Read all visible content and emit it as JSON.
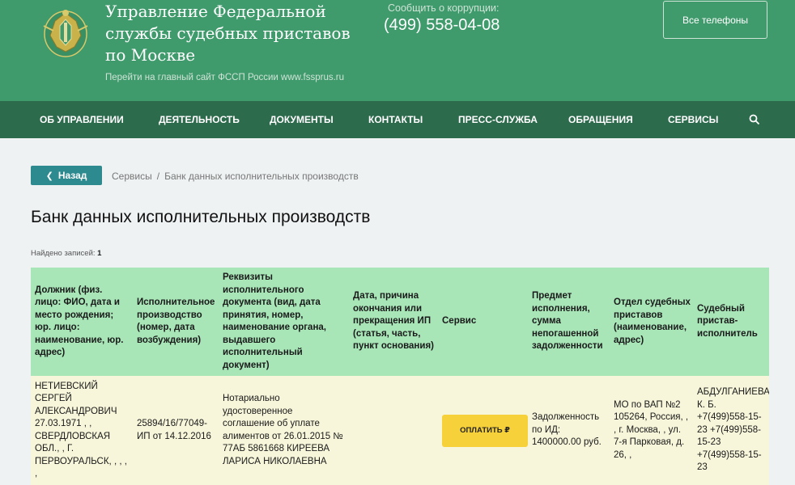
{
  "header": {
    "org_title": "Управление Федеральной службы судебных приставов по Москве",
    "main_site_link": "Перейти на главный сайт ФССП России www.fssprus.ru",
    "corruption_label": "Сообщить о коррупции:",
    "corruption_phone": "(499) 558-04-08",
    "all_phones": "Все телефоны"
  },
  "nav": {
    "items": [
      "ОБ УПРАВЛЕНИИ",
      "ДЕЯТЕЛЬНОСТЬ",
      "ДОКУМЕНТЫ",
      "КОНТАКТЫ",
      "ПРЕСС-СЛУЖБА",
      "ОБРАЩЕНИЯ",
      "СЕРВИСЫ"
    ]
  },
  "breadcrumb": {
    "back_label": "Назад",
    "items": [
      "Сервисы",
      "Банк данных исполнительных производств"
    ],
    "separator": "/"
  },
  "page": {
    "title": "Банк данных исполнительных производств",
    "records_label": "Найдено записей:",
    "records_count": "1"
  },
  "table": {
    "headers": [
      "Должник (физ. лицо: ФИО, дата и место рождения; юр. лицо: наименование, юр. адрес)",
      "Исполнительное производство (номер, дата возбуждения)",
      "Реквизиты исполнительного документа (вид, дата принятия, номер, наименование органа, выдавшего исполнительный документ)",
      "Дата, причина окончания или прекращения ИП (статья, часть, пункт основания)",
      "Сервис",
      "Предмет исполнения, сумма непогашенной задолженности",
      "Отдел судебных приставов (наименование, адрес)",
      "Судебный пристав-исполнитель"
    ],
    "rows": [
      {
        "debtor": "НЕТИЕВСКИЙ СЕРГЕЙ АЛЕКСАНДРОВИЧ 27.03.1971 , , СВЕРДЛОВСКАЯ ОБЛ., , Г. ПЕРВОУРАЛЬСК, , , , ,",
        "proceeding": "25894/16/77049-ИП от 14.12.2016",
        "document": "Нотариально удостоверенное соглашение об уплате алиментов от 26.01.2015 № 77АБ 5861668 КИРЕЕВА ЛАРИСА НИКОЛАЕВНА",
        "end_info": "",
        "service_button": "ОПЛАТИТЬ ₽",
        "subject": "Задолженность по ИД: 1400000.00 руб.",
        "department": "МО по ВАП №2 105264, Россия, , , г. Москва, , ул. 7-я Парковая, д. 26, ,",
        "bailiff": "АБДУЛГАНИЕВА К. Б. +7(499)558-15-23 +7(499)558-15-23 +7(499)558-15-23"
      }
    ]
  },
  "colors": {
    "header_green": "#3f9a6c",
    "nav_green": "#2d6b4d",
    "back_teal": "#2d8a8f",
    "table_head": "#a8e6b8",
    "table_row": "#f7f6da",
    "pay_yellow": "#f7d13a"
  }
}
